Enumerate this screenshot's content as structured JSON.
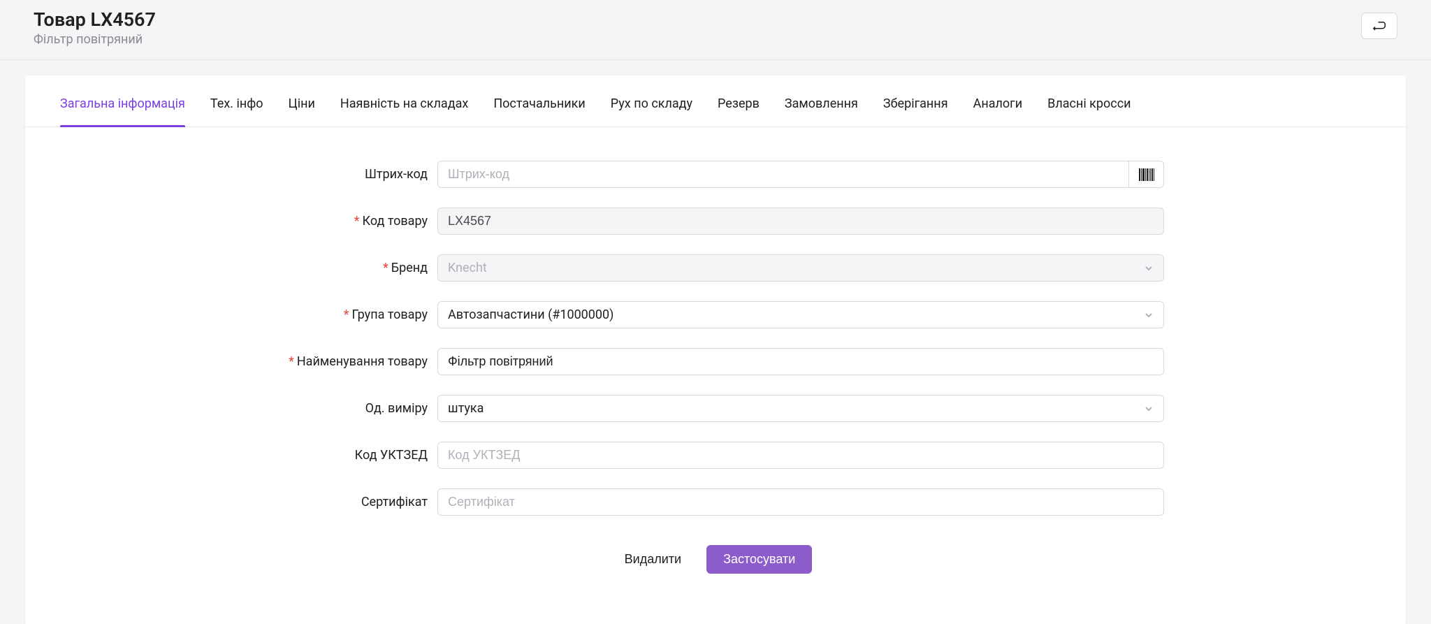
{
  "header": {
    "title": "Товар LX4567",
    "subtitle": "Фільтр повітряний"
  },
  "tabs": [
    "Загальна інформація",
    "Тех. інфо",
    "Ціни",
    "Наявність на складах",
    "Постачальники",
    "Рух по складу",
    "Резерв",
    "Замовлення",
    "Зберігання",
    "Аналоги",
    "Власні кросси"
  ],
  "form": {
    "barcode": {
      "label": "Штрих-код",
      "placeholder": "Штрих-код",
      "value": ""
    },
    "code": {
      "label": "Код товару",
      "value": "LX4567"
    },
    "brand": {
      "label": "Бренд",
      "value": "Knecht"
    },
    "group": {
      "label": "Група товару",
      "value": "Автозапчастини (#1000000)"
    },
    "name": {
      "label": "Найменування товару",
      "value": "Фільтр повітряний"
    },
    "unit": {
      "label": "Од. виміру",
      "value": "штука"
    },
    "uktzed": {
      "label": "Код УКТЗЕД",
      "placeholder": "Код УКТЗЕД",
      "value": ""
    },
    "cert": {
      "label": "Сертифікат",
      "placeholder": "Сертифікат",
      "value": ""
    }
  },
  "actions": {
    "delete": "Видалити",
    "apply": "Застосувати"
  }
}
